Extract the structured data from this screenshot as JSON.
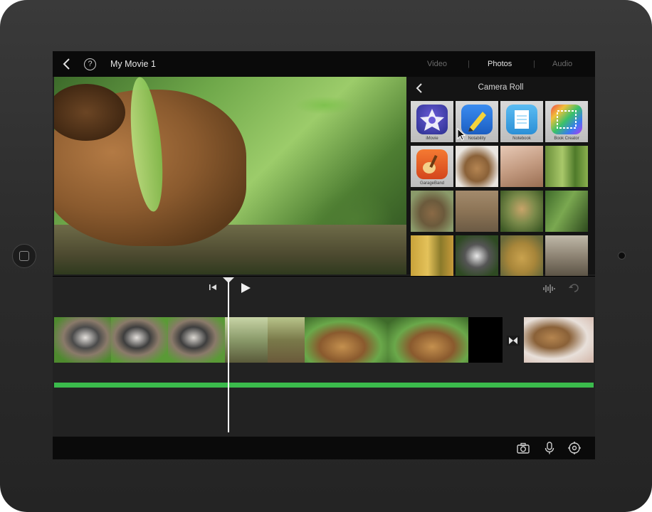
{
  "header": {
    "title": "My Movie 1",
    "help_glyph": "?",
    "tabs": [
      {
        "label": "Video",
        "active": false
      },
      {
        "label": "Photos",
        "active": true
      },
      {
        "label": "Audio",
        "active": false
      }
    ],
    "tab_separator": "|"
  },
  "browser": {
    "title": "Camera Roll",
    "apps": [
      {
        "name": "iMovie",
        "color": "#2a2f8f"
      },
      {
        "name": "Notability",
        "color": "#1c6fd9"
      },
      {
        "name": "Notebook",
        "color": "#3aa3e8"
      },
      {
        "name": "Book Creator",
        "color": "#e84a8a"
      },
      {
        "name": "GarageBand",
        "color": "#e8541c"
      }
    ],
    "photos": [
      {
        "subject": "deer"
      },
      {
        "subject": "classroom"
      },
      {
        "subject": "grass"
      },
      {
        "subject": "groundhog"
      },
      {
        "subject": "dirt"
      },
      {
        "subject": "deer-sculpture"
      },
      {
        "subject": "plants"
      },
      {
        "subject": "reeds"
      },
      {
        "subject": "raccoon"
      },
      {
        "subject": "bird"
      },
      {
        "subject": "wood"
      }
    ]
  },
  "timeline": {
    "clips": [
      "raccoon",
      "raccoon",
      "raccoon",
      "marsh",
      "marsh",
      "groundhog",
      "groundhog",
      "groundhog",
      "black",
      "deer"
    ],
    "audio_track_color": "#3bbb4c"
  },
  "colors": {
    "accent_green": "#3bbb4c",
    "bar_bg": "#0a0a0a",
    "timeline_bg": "#222222"
  },
  "icons": [
    "back-icon",
    "help-icon",
    "skip-to-start-icon",
    "play-icon",
    "audio-waveform-icon",
    "undo-icon",
    "camera-icon",
    "microphone-icon",
    "settings-icon",
    "transition-icon"
  ]
}
